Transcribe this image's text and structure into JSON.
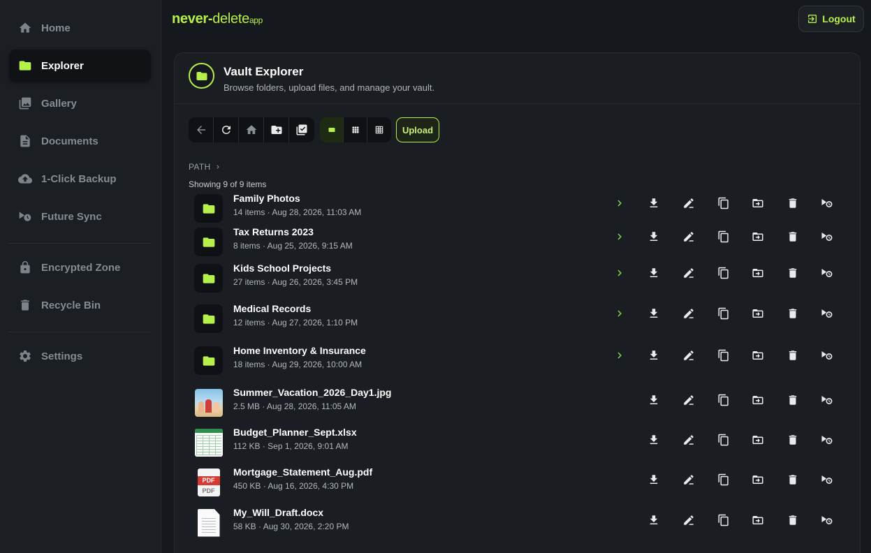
{
  "brand": {
    "part1": "never-",
    "part2": "delete",
    "part3": "app"
  },
  "header": {
    "logout_label": "Logout"
  },
  "sidebar": {
    "items": [
      {
        "label": "Home",
        "icon": "home-icon"
      },
      {
        "label": "Explorer",
        "icon": "folder-icon",
        "active": true
      },
      {
        "label": "Gallery",
        "icon": "gallery-icon"
      },
      {
        "label": "Documents",
        "icon": "document-icon"
      },
      {
        "label": "1-Click Backup",
        "icon": "cloud-upload-icon"
      },
      {
        "label": "Future Sync",
        "icon": "future-sync-icon"
      },
      {
        "label": "Encrypted Zone",
        "icon": "lock-icon"
      },
      {
        "label": "Recycle Bin",
        "icon": "trash-icon"
      },
      {
        "label": "Settings",
        "icon": "gear-icon"
      }
    ]
  },
  "explorer": {
    "title": "Vault Explorer",
    "subtitle": "Browse folders, upload files, and manage your vault.",
    "upload_label": "Upload",
    "path_label": "PATH",
    "showing_text": "Showing 9 of 9 items",
    "accent_color": "#b6f04a"
  },
  "items": [
    {
      "name": "Family Photos",
      "meta": "14 items · Aug 28, 2026, 11:03 AM",
      "type": "folder"
    },
    {
      "name": "Tax Returns 2023",
      "meta": "8 items · Aug 25, 2026, 9:15 AM",
      "type": "folder"
    },
    {
      "name": "Kids School Projects",
      "meta": "27 items · Aug 26, 2026, 3:45 PM",
      "type": "folder"
    },
    {
      "name": "Medical Records",
      "meta": "12 items · Aug 27, 2026, 1:10 PM",
      "type": "folder"
    },
    {
      "name": "Home Inventory & Insurance",
      "meta": "18 items · Aug 29, 2026, 10:00 AM",
      "type": "folder"
    },
    {
      "name": "Summer_Vacation_2026_Day1.jpg",
      "meta": "2.5 MB · Aug 28, 2026, 11:05 AM",
      "type": "image"
    },
    {
      "name": "Budget_Planner_Sept.xlsx",
      "meta": "112 KB · Sep 1, 2026, 9:01 AM",
      "type": "spreadsheet"
    },
    {
      "name": "Mortgage_Statement_Aug.pdf",
      "meta": "450 KB · Aug 16, 2026, 4:30 PM",
      "type": "pdf",
      "thumb_text": "PDF"
    },
    {
      "name": "My_Will_Draft.docx",
      "meta": "58 KB · Aug 30, 2026, 2:20 PM",
      "type": "document"
    }
  ]
}
